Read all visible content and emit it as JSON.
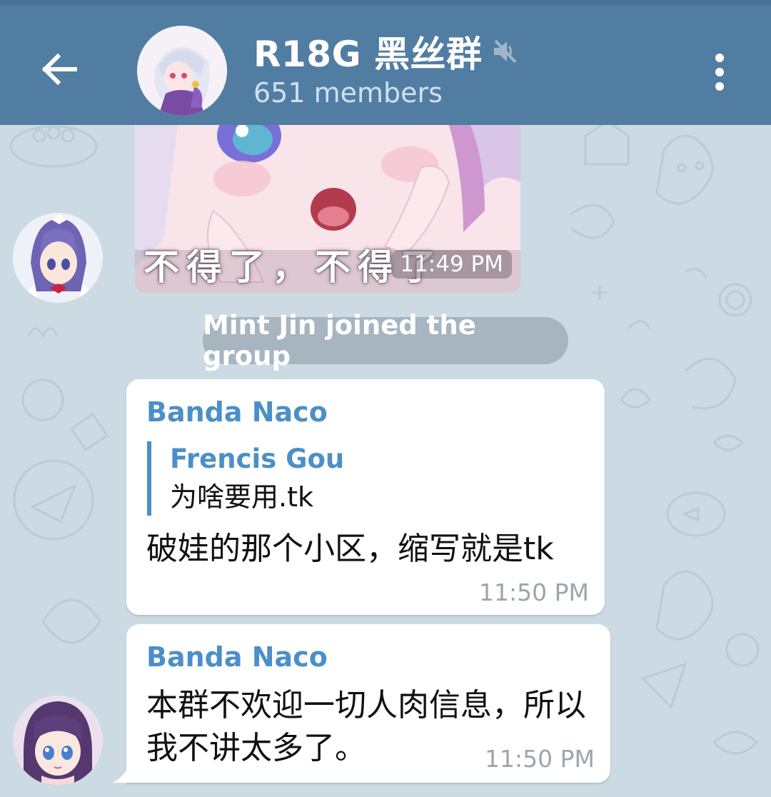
{
  "header": {
    "title": "R18G 黑丝群",
    "member_count": "651 members",
    "back_icon": "arrow-left-icon",
    "mute_icon": "muted-speaker-icon",
    "menu_icon": "more-vertical-icon"
  },
  "messages": [
    {
      "type": "sticker",
      "caption": "不得了，不得了",
      "time": "11:49 PM"
    },
    {
      "type": "service",
      "text": "Mint Jin joined the group"
    },
    {
      "type": "text",
      "sender": "Banda Naco",
      "reply": {
        "name": "Frencis Gou",
        "text": "为啥要用.tk"
      },
      "text": "破娃的那个小区，缩写就是tk",
      "time": "11:50 PM"
    },
    {
      "type": "text",
      "sender": "Banda Naco",
      "text": "本群不欢迎一切人肉信息，所以我不讲太多了。",
      "time": "11:50 PM"
    }
  ],
  "colors": {
    "header_bg": "#527da3",
    "chat_bg": "#ccdae3",
    "accent_blue": "#4c8fc8",
    "time_grey": "#9aa6b0"
  }
}
